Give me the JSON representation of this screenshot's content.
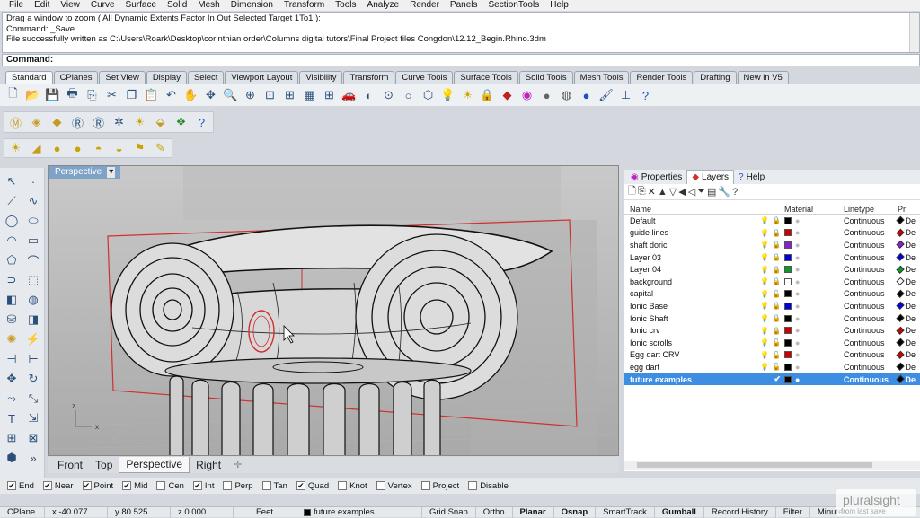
{
  "menu": [
    "File",
    "Edit",
    "View",
    "Curve",
    "Surface",
    "Solid",
    "Mesh",
    "Dimension",
    "Transform",
    "Tools",
    "Analyze",
    "Render",
    "Panels",
    "SectionTools",
    "Help"
  ],
  "history": [
    "Drag a window to zoom ( All  Dynamic  Extents  Factor  In  Out  Selected  Target  1To1 ):",
    "Command: _Save",
    "File successfully written as C:\\Users\\Roark\\Desktop\\corinthian order\\Columns digital tutors\\Final Project files Congdon\\12.12_Begin.Rhino.3dm"
  ],
  "command_label": "Command:",
  "tabs": [
    "Standard",
    "CPlanes",
    "Set View",
    "Display",
    "Select",
    "Viewport Layout",
    "Visibility",
    "Transform",
    "Curve Tools",
    "Surface Tools",
    "Solid Tools",
    "Mesh Tools",
    "Render Tools",
    "Drafting",
    "New in V5"
  ],
  "toolbar_icons": [
    "new-icon",
    "open-icon",
    "save-icon",
    "print-icon",
    "import-icon",
    "cut-icon",
    "copy-icon",
    "paste-icon",
    "undo-icon",
    "pan-icon",
    "rotate-icon",
    "zoom-window-icon",
    "zoom-extents-icon",
    "zoom-selected-icon",
    "zoom-all-icon",
    "grid-icon",
    "four-views-icon",
    "car-icon",
    "render-preview-icon",
    "cplane-icon",
    "circle-icon",
    "mesh-icon",
    "light-icon",
    "bulb-icon",
    "lock-icon",
    "material-icon",
    "color-wheel-icon",
    "sphere-icon",
    "shaded-icon",
    "render-sphere-icon",
    "paint-icon",
    "dims-icon",
    "help-icon"
  ],
  "viewport": {
    "label": "Perspective",
    "dropdown": "▾",
    "axis_x": "x",
    "axis_z": "z"
  },
  "view_tabs": [
    "Front",
    "Top",
    "Perspective",
    "Right",
    "✛"
  ],
  "panel": {
    "tabs": [
      "Properties",
      "Layers",
      "Help"
    ],
    "headers": {
      "name": "Name",
      "material": "Material",
      "linetype": "Linetype",
      "print": "Pr"
    },
    "layers": [
      {
        "name": "Default",
        "color": "#000000",
        "linetype": "Continuous",
        "locked": true
      },
      {
        "name": "guide lines",
        "color": "#cc0000",
        "linetype": "Continuous",
        "locked": true
      },
      {
        "name": "shaft doric",
        "color": "#8a1fd0",
        "linetype": "Continuous",
        "locked": true
      },
      {
        "name": "Layer 03",
        "color": "#0000dd",
        "linetype": "Continuous",
        "locked": true
      },
      {
        "name": "Layer 04",
        "color": "#0a9a2a",
        "linetype": "Continuous",
        "locked": true
      },
      {
        "name": "background",
        "color": "#ffffff",
        "linetype": "Continuous",
        "locked": true
      },
      {
        "name": "capital",
        "color": "#000000",
        "linetype": "Continuous",
        "locked": false
      },
      {
        "name": "Ionic Base",
        "color": "#0000dd",
        "linetype": "Continuous",
        "locked": true
      },
      {
        "name": "Ionic Shaft",
        "color": "#000000",
        "linetype": "Continuous",
        "locked": true
      },
      {
        "name": "Ionic crv",
        "color": "#cc0000",
        "linetype": "Continuous",
        "locked": true
      },
      {
        "name": "Ionic scrolls",
        "color": "#000000",
        "linetype": "Continuous",
        "locked": false
      },
      {
        "name": "Egg dart CRV",
        "color": "#cc0000",
        "linetype": "Continuous",
        "locked": false
      },
      {
        "name": "egg dart",
        "color": "#000000",
        "linetype": "Continuous",
        "locked": false
      },
      {
        "name": "future examples",
        "color": "#000000",
        "linetype": "Continuous",
        "locked": false,
        "selected": true
      }
    ],
    "print_partial": "De"
  },
  "osnap": [
    {
      "label": "End",
      "checked": true
    },
    {
      "label": "Near",
      "checked": true
    },
    {
      "label": "Point",
      "checked": true
    },
    {
      "label": "Mid",
      "checked": true
    },
    {
      "label": "Cen",
      "checked": false
    },
    {
      "label": "Int",
      "checked": true
    },
    {
      "label": "Perp",
      "checked": false
    },
    {
      "label": "Tan",
      "checked": false
    },
    {
      "label": "Quad",
      "checked": true
    },
    {
      "label": "Knot",
      "checked": false
    },
    {
      "label": "Vertex",
      "checked": false
    },
    {
      "label": "Project",
      "checked": false
    },
    {
      "label": "Disable",
      "checked": false
    }
  ],
  "status": {
    "cplane": "CPlane",
    "x": "x -40.077",
    "y": "y 80.525",
    "z": "z 0.000",
    "units": "Feet",
    "layer": "future examples",
    "grid_snap": "Grid Snap",
    "ortho": "Ortho",
    "planar": "Planar",
    "osnap": "Osnap",
    "smarttrack": "SmartTrack",
    "gumball": "Gumball",
    "record_history": "Record History",
    "filter": "Filter",
    "minutes": "Minutes"
  },
  "watermark": {
    "brand": "pluralsight",
    "sub": "from last save"
  }
}
